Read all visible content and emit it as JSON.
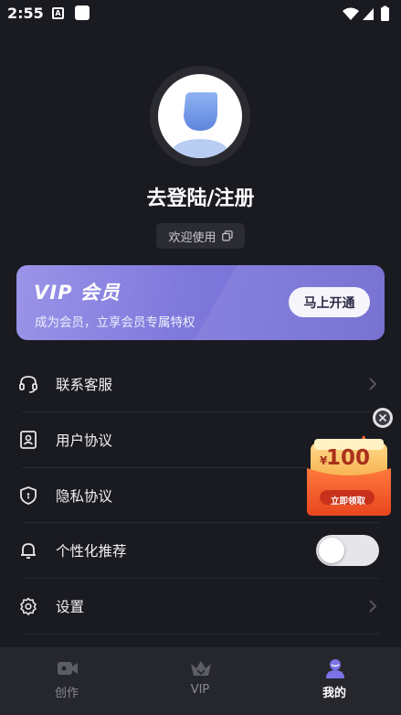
{
  "status_bar": {
    "time": "2:55",
    "notif_letter": "A"
  },
  "profile": {
    "title": "去登陆/注册",
    "welcome": "欢迎使用"
  },
  "vip_banner": {
    "logo_text": "VIP 会员",
    "subtitle": "成为会员，立享会员专属特权",
    "button_label": "马上开通"
  },
  "menu": {
    "items": [
      {
        "label": "联系客服",
        "icon": "headset-icon"
      },
      {
        "label": "用户协议",
        "icon": "user-document-icon"
      },
      {
        "label": "隐私协议",
        "icon": "shield-icon"
      },
      {
        "label": "个性化推荐",
        "icon": "bell-icon"
      },
      {
        "label": "设置",
        "icon": "gear-icon"
      }
    ],
    "personalized_enabled": false
  },
  "coupon": {
    "currency": "¥",
    "amount": "100",
    "button": "立即领取"
  },
  "bottom_nav": {
    "items": [
      {
        "label": "创作",
        "icon": "video-camera-icon",
        "active": false
      },
      {
        "label": "VIP",
        "icon": "crown-icon",
        "active": false
      },
      {
        "label": "我的",
        "icon": "person-icon",
        "active": true
      }
    ]
  },
  "colors": {
    "background": "#1a1a21",
    "vip_gradient_start": "#9b94e8",
    "vip_gradient_end": "#6d67cf",
    "nav_background": "#26262d",
    "active_accent": "#7b73e6"
  }
}
